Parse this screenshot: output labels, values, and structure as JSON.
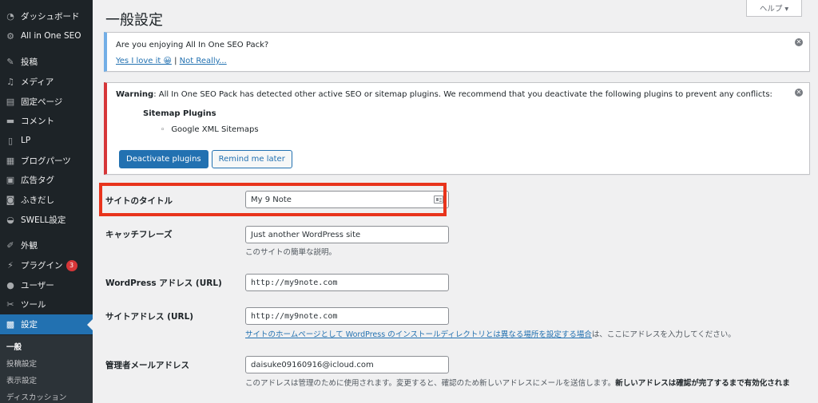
{
  "sidebar": {
    "items": [
      {
        "label": "ダッシュボード",
        "icon": "dashboard-icon"
      },
      {
        "label": "All in One SEO",
        "icon": "gear-icon"
      },
      {
        "label": "投稿",
        "icon": "pin-icon"
      },
      {
        "label": "メディア",
        "icon": "media-icon"
      },
      {
        "label": "固定ページ",
        "icon": "page-icon"
      },
      {
        "label": "コメント",
        "icon": "comment-icon"
      },
      {
        "label": "LP",
        "icon": "document-icon"
      },
      {
        "label": "ブログパーツ",
        "icon": "parts-icon"
      },
      {
        "label": "広告タグ",
        "icon": "ad-tag-icon"
      },
      {
        "label": "ふきだし",
        "icon": "speech-bubble-icon"
      },
      {
        "label": "SWELL設定",
        "icon": "swell-icon"
      },
      {
        "label": "外観",
        "icon": "brush-icon"
      },
      {
        "label": "プラグイン",
        "icon": "plugin-icon",
        "badge": "3"
      },
      {
        "label": "ユーザー",
        "icon": "user-icon"
      },
      {
        "label": "ツール",
        "icon": "wrench-icon"
      },
      {
        "label": "設定",
        "icon": "settings-icon"
      }
    ],
    "submenu": [
      "一般",
      "投稿設定",
      "表示設定",
      "ディスカッション"
    ]
  },
  "header": {
    "title": "一般設定",
    "help": "ヘルプ ▾"
  },
  "notice_seo": {
    "question": "Are you enjoying All In One SEO Pack?",
    "yes": "Yes I love it 😀",
    "sep": " | ",
    "no": "Not Really..."
  },
  "notice_warn": {
    "strong": "Warning",
    "message": ": All In One SEO Pack has detected other active SEO or sitemap plugins. We recommend that you deactivate the following plugins to prevent any conflicts:",
    "group": "Sitemap Plugins",
    "plugin": "Google XML Sitemaps",
    "deactivate": "Deactivate plugins",
    "remind": "Remind me later"
  },
  "form": {
    "site_title_label": "サイトのタイトル",
    "site_title_value": "My 9 Note",
    "tagline_label": "キャッチフレーズ",
    "tagline_value": "Just another WordPress site",
    "tagline_desc": "このサイトの簡単な説明。",
    "wp_url_label": "WordPress アドレス (URL)",
    "wp_url_value": "http://my9note.com",
    "site_url_label": "サイトアドレス (URL)",
    "site_url_value": "http://my9note.com",
    "site_url_desc_link": "サイトのホームページとして WordPress のインストールディレクトリとは異なる場所を設定する場合",
    "site_url_desc_rest": "は、ここにアドレスを入力してください。",
    "email_label": "管理者メールアドレス",
    "email_value": "daisuke09160916@icloud.com",
    "email_desc": "このアドレスは管理のために使用されます。変更すると、確認のため新しいアドレスにメールを送信します。",
    "email_desc_bold": "新しいアドレスは確認が完了するまで有効化されま"
  },
  "colors": {
    "sidebar_bg": "#1d2327",
    "accent": "#2271b1",
    "warning": "#d63638",
    "highlight": "#e8341c"
  }
}
